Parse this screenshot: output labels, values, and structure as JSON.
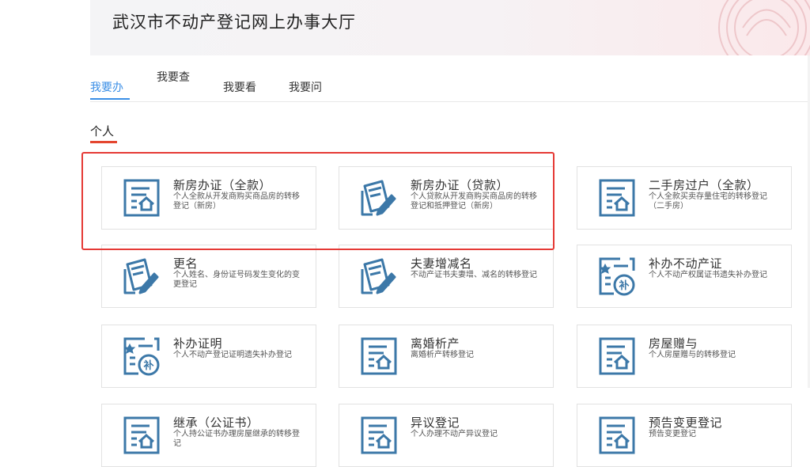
{
  "header": {
    "title": "武汉市不动产登记网上办事大厅"
  },
  "tabs": [
    {
      "label": "我要办",
      "active": true
    },
    {
      "label": "我要查",
      "active": false
    },
    {
      "label": "我要看",
      "active": false
    },
    {
      "label": "我要问",
      "active": false
    }
  ],
  "section": {
    "label": "个人"
  },
  "colors": {
    "accent": "#3a8ee6",
    "icon": "#3c78a8",
    "highlight": "#e53935",
    "section_underline": "#e4462f"
  },
  "cards": [
    {
      "title": "新房办证（全款）",
      "desc": "个人全款从开发商购买商品房的转移登记（新房）",
      "icon": "house-document-icon"
    },
    {
      "title": "新房办证（贷款）",
      "desc": "个人贷款从开发商购买商品房的转移登记和抵押登记（新房）",
      "icon": "document-pen-icon"
    },
    {
      "title": "二手房过户（全款）",
      "desc": "个人全款买卖存量住宅的转移登记（二手房）",
      "icon": "house-document-icon"
    },
    {
      "title": "更名",
      "desc": "个人姓名、身份证号码发生变化的变更登记",
      "icon": "document-pen-icon"
    },
    {
      "title": "夫妻增减名",
      "desc": "不动产证书夫妻增、减名的转移登记",
      "icon": "document-pen-icon"
    },
    {
      "title": "补办不动产证",
      "desc": "个人不动产权属证书遗失补办登记",
      "icon": "certificate-supplement-icon"
    },
    {
      "title": "补办证明",
      "desc": "个人不动产登记证明遗失补办登记",
      "icon": "certificate-supplement-icon"
    },
    {
      "title": "离婚析产",
      "desc": "离婚析产转移登记",
      "icon": "house-document-icon"
    },
    {
      "title": "房屋赠与",
      "desc": "个人房屋赠与的转移登记",
      "icon": "house-document-icon"
    },
    {
      "title": "继承（公证书）",
      "desc": "个人持公证书办理房屋继承的转移登记",
      "icon": "house-document-icon"
    },
    {
      "title": "异议登记",
      "desc": "个人办理不动产异议登记",
      "icon": "house-document-icon"
    },
    {
      "title": "预告变更登记",
      "desc": "预告变更登记",
      "icon": "house-document-icon"
    }
  ]
}
